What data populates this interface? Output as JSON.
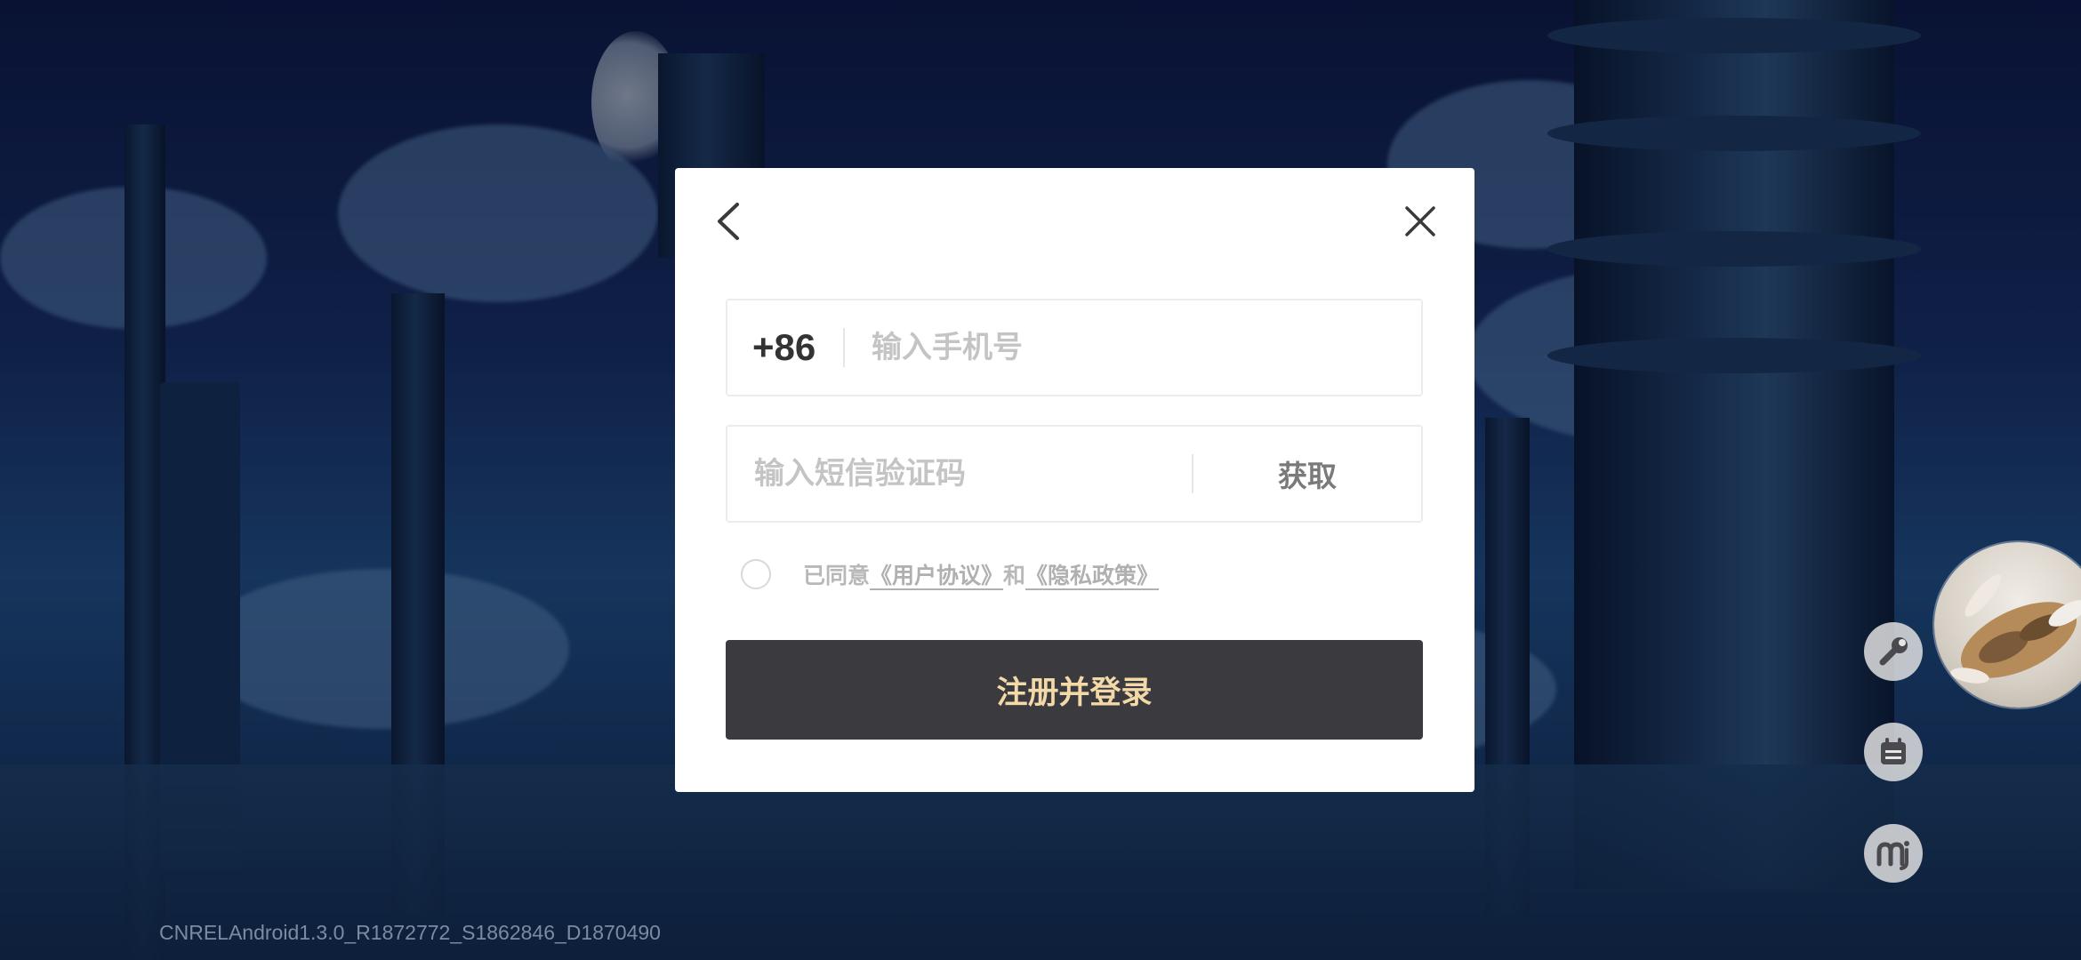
{
  "dialog": {
    "country_code": "+86",
    "phone_placeholder": "输入手机号",
    "code_placeholder": "输入短信验证码",
    "get_code_label": "获取",
    "agreement": {
      "prefix": "已同意",
      "user_agreement": "《用户协议》",
      "and": "和",
      "privacy_policy": "《隐私政策》"
    },
    "submit_label": "注册并登录"
  },
  "tools": [
    "wrench-icon",
    "calendar-icon",
    "mi-logo-icon"
  ],
  "version_text": "CNRELAndroid1.3.0_R1872772_S1862846_D1870490",
  "colors": {
    "submit_bg": "#3b3b3f",
    "submit_text": "#f4d9a8",
    "modal_bg": "#ffffff"
  }
}
